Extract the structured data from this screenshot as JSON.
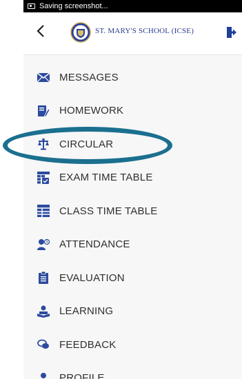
{
  "status_bar": {
    "text": "Saving screenshot..."
  },
  "header": {
    "school_name": "ST. MARY'S SCHOOL (ICSE)",
    "back_icon": "chevron-left-icon",
    "logout_icon": "logout-icon"
  },
  "menu": {
    "items": [
      {
        "label": "MESSAGES",
        "icon": "envelope-icon"
      },
      {
        "label": "HOMEWORK",
        "icon": "notebook-pen-icon"
      },
      {
        "label": "CIRCULAR",
        "icon": "circular-icon"
      },
      {
        "label": "EXAM TIME TABLE",
        "icon": "exam-table-icon"
      },
      {
        "label": "CLASS TIME TABLE",
        "icon": "class-table-icon"
      },
      {
        "label": "ATTENDANCE",
        "icon": "attendance-icon"
      },
      {
        "label": "EVALUATION",
        "icon": "clipboard-icon"
      },
      {
        "label": "LEARNING",
        "icon": "learning-icon"
      },
      {
        "label": "FEEDBACK",
        "icon": "chat-icon"
      },
      {
        "label": "PROFILE",
        "icon": "profile-icon"
      }
    ]
  },
  "colors": {
    "accent": "#2a3b8f",
    "highlight_ring": "#1b6f8f",
    "logout": "#1e3f9a"
  }
}
